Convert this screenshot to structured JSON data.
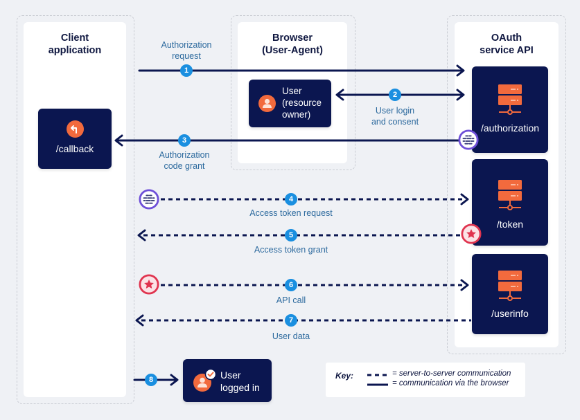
{
  "lanes": {
    "client": {
      "title_line1": "Client",
      "title_line2": "application"
    },
    "browser": {
      "title_line1": "Browser",
      "title_line2": "(User-Agent)"
    },
    "oauth": {
      "title_line1": "OAuth",
      "title_line2": "service API"
    }
  },
  "nodes": {
    "callback": {
      "label": "/callback",
      "icon": "return-arrow-icon"
    },
    "user_owner": {
      "line1": "User",
      "line2": "(resource",
      "line3": "owner)",
      "icon": "user-icon"
    },
    "authorization": {
      "label": "/authorization",
      "icon": "server-icon"
    },
    "token": {
      "label": "/token",
      "icon": "server-icon"
    },
    "userinfo": {
      "label": "/userinfo",
      "icon": "server-icon"
    },
    "logged_in": {
      "line1": "User",
      "line2": "logged in",
      "icon": "user-check-icon"
    }
  },
  "flows": [
    {
      "step": "1",
      "line1": "Authorization",
      "line2": "request",
      "style": "solid"
    },
    {
      "step": "2",
      "line1": "User login",
      "line2": "and consent",
      "style": "solid"
    },
    {
      "step": "3",
      "line1": "Authorization",
      "line2": "code grant",
      "style": "solid"
    },
    {
      "step": "4",
      "line1": "Access token request",
      "style": "dashed"
    },
    {
      "step": "5",
      "line1": "Access token grant",
      "style": "dashed"
    },
    {
      "step": "6",
      "line1": "API call",
      "style": "dashed"
    },
    {
      "step": "7",
      "line1": "User data",
      "style": "dashed"
    },
    {
      "step": "8",
      "style": "solid"
    }
  ],
  "key": {
    "title": "Key:",
    "dashed_text": "= server-to-server communication",
    "solid_text": "= communication via the browser"
  },
  "colors": {
    "navy": "#0b1650",
    "orange": "#f26a3d",
    "badge_blue": "#1a8fe0",
    "label_blue": "#2d6a9e",
    "code_purple": "#6e4fd8",
    "token_red": "#e0344f"
  }
}
